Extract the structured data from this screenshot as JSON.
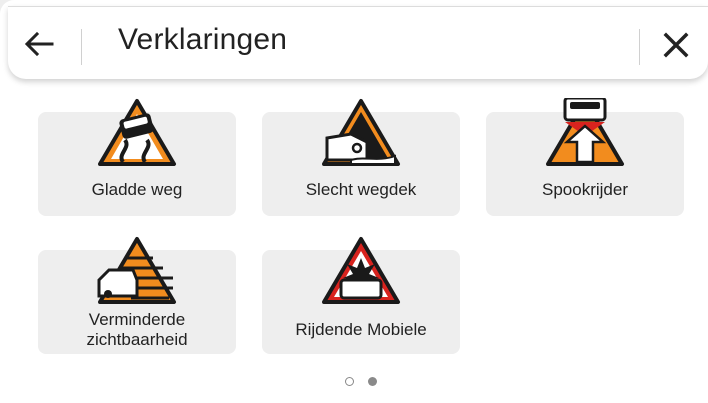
{
  "header": {
    "title": "Verklaringen"
  },
  "tiles": [
    {
      "label": "Gladde weg",
      "icon": "slippery-road-icon"
    },
    {
      "label": "Slecht wegdek",
      "icon": "bad-road-surface-icon"
    },
    {
      "label": "Spookrijder",
      "icon": "ghost-driver-icon"
    },
    {
      "label": "Verminderde zichtbaarheid",
      "icon": "reduced-visibility-icon"
    },
    {
      "label": "Rijdende Mobiele",
      "icon": "mobile-roadworks-icon"
    }
  ],
  "pagination": {
    "pages": 2,
    "active": 2
  },
  "colors": {
    "orange": "#f28c1e",
    "red": "#d8231e"
  }
}
